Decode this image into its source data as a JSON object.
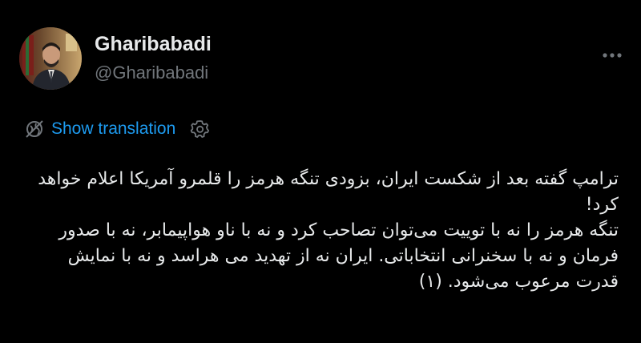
{
  "author": {
    "display_name": "Gharibabadi",
    "handle": "@Gharibabadi",
    "avatar_icon": "profile-photo"
  },
  "more_icon": "more-horizontal-icon",
  "translation": {
    "icon": "globe-icon",
    "label": "Show translation",
    "settings_icon": "gear-icon"
  },
  "tweet": {
    "paragraphs": [
      "ترامپ گفته بعد از شکست ایران، بزودی تنگه هرمز را قلمرو آمریکا اعلام خواهد کرد!",
      "تنگه هرمز را نه با توییت می‌توان تصاحب کرد و نه با ناو هواپیمابر، نه با صدور فرمان و نه با سخنرانی انتخاباتی. ایران نه از تهدید می هراسد و نه با نمایش قدرت مرعوب می‌شود. (۱)"
    ]
  },
  "colors": {
    "background": "#000000",
    "primary_text": "#e7e9ea",
    "secondary_text": "#71767b",
    "link": "#1d9bf0"
  }
}
